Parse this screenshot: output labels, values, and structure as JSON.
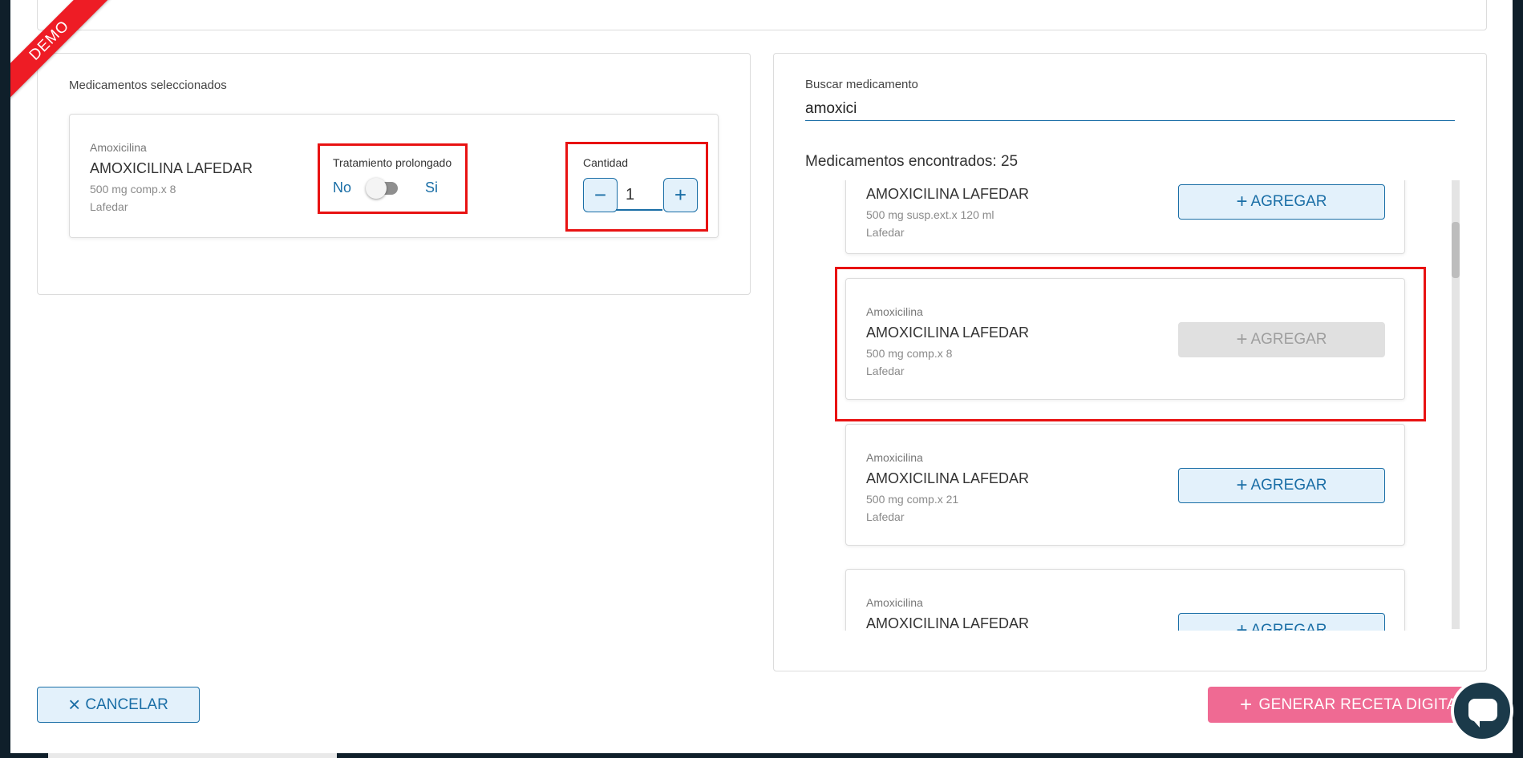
{
  "ribbon": {
    "label": "DEMO"
  },
  "selected": {
    "section_label": "Medicamentos seleccionados",
    "item": {
      "generic": "Amoxicilina",
      "brand": "AMOXICILINA LAFEDAR",
      "presentation": "500 mg comp.x 8",
      "lab": "Lafedar"
    },
    "treatment": {
      "label": "Tratamiento prolongado",
      "off_label": "No",
      "on_label": "Si",
      "enabled": false
    },
    "quantity": {
      "label": "Cantidad",
      "value": "1",
      "minus": "−",
      "plus": "+"
    }
  },
  "search": {
    "label": "Buscar medicamento",
    "value": "amoxici",
    "results_label": "Medicamentos encontrados: 25",
    "add_label": "AGREGAR",
    "results": [
      {
        "generic": "",
        "brand": "AMOXICILINA LAFEDAR",
        "presentation": "500 mg susp.ext.x 120 ml",
        "lab": "Lafedar",
        "disabled": false
      },
      {
        "generic": "Amoxicilina",
        "brand": "AMOXICILINA LAFEDAR",
        "presentation": "500 mg comp.x 8",
        "lab": "Lafedar",
        "disabled": true
      },
      {
        "generic": "Amoxicilina",
        "brand": "AMOXICILINA LAFEDAR",
        "presentation": "500 mg comp.x 21",
        "lab": "Lafedar",
        "disabled": false
      },
      {
        "generic": "Amoxicilina",
        "brand": "AMOXICILINA LAFEDAR",
        "presentation": "",
        "lab": "",
        "disabled": false
      }
    ]
  },
  "footer": {
    "cancel_label": "CANCELAR",
    "cancel_icon": "×",
    "generate_label": "GENERAR RECETA DIGITAL",
    "generate_icon": "+"
  },
  "colors": {
    "accent": "#1a6ea6",
    "primary_pink": "#ef6a93",
    "highlight": "#e81212",
    "ribbon": "#ee1c25"
  }
}
